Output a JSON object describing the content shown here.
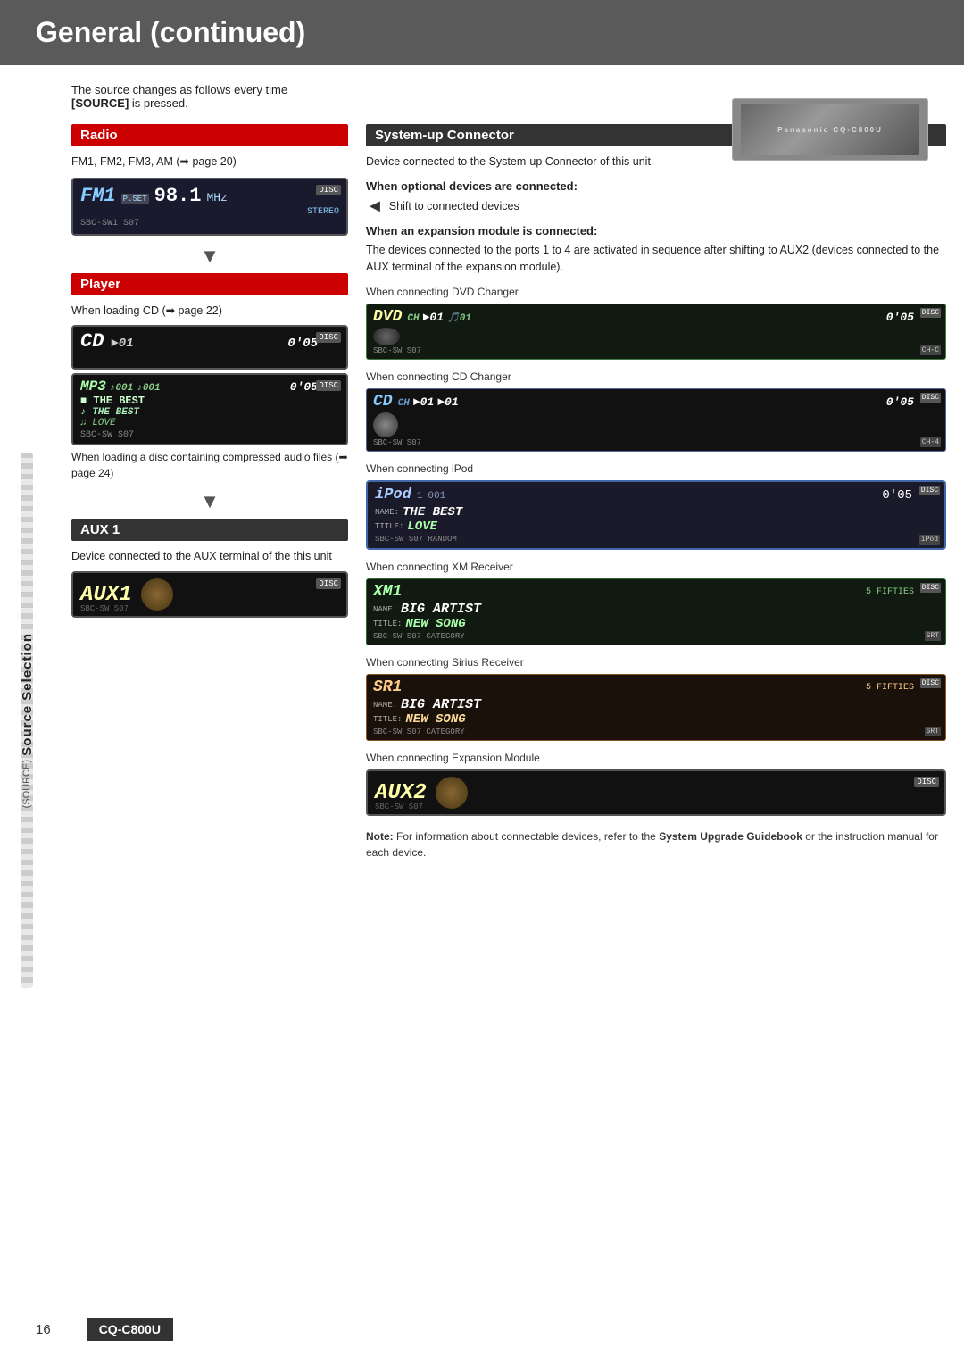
{
  "page": {
    "title": "General (continued)",
    "page_number": "16",
    "model": "CQ-C800U"
  },
  "intro": {
    "line1": "The source changes as follows every time",
    "line2": "[SOURCE] is pressed."
  },
  "sidebar": {
    "main_label": "Source Selection",
    "sub_label": "(SOURCE)"
  },
  "radio_section": {
    "title": "Radio",
    "description": "FM1, FM2, FM3, AM (➡ page 20)",
    "display": {
      "station": "FM1",
      "pset": "P.SET",
      "freq": "98.1",
      "unit": "MHz",
      "badge": "DISC",
      "bottom": "SBC-SW1 S07",
      "stereo": "STEREO"
    }
  },
  "player_section": {
    "title": "Player",
    "description_cd": "When loading CD (➡ page 22)",
    "description_mp3": "When loading a disc containing compressed audio files (➡ page 24)",
    "cd_display": {
      "label": "CD",
      "track": "►01",
      "time": "0'05",
      "badge": "DISC"
    },
    "mp3_display": {
      "label": "MP3",
      "folder": "♪001",
      "track": "♪001",
      "time": "0'05",
      "badge": "DISC",
      "line1": "■ THE BEST",
      "line2": "♪ THE BEST",
      "line3": "♫ LOVE",
      "bottom": "SBC-SW S07"
    }
  },
  "aux1_section": {
    "title": "AUX 1",
    "description": "Device connected to the AUX terminal of the this unit",
    "display": {
      "label": "AUX1",
      "badge": "DISC",
      "bottom": "SBC-SW S07"
    }
  },
  "system_up_section": {
    "title": "System-up Connector",
    "description": "Device connected to the System-up Connector of this unit",
    "when_optional": {
      "header": "When optional devices are connected:",
      "text": "Shift to connected devices"
    },
    "when_expansion": {
      "header": "When an expansion module is connected:",
      "text": "The devices connected to the ports 1 to 4 are activated in sequence after shifting to AUX2 (devices connected to the AUX terminal of the expansion module)."
    },
    "dvd_changer": {
      "when": "When connecting DVD Changer",
      "display": {
        "label": "DVD",
        "ch_label": "CH",
        "arrow": "►01",
        "folder": "🎵01",
        "time": "0'05",
        "badge": "DISC",
        "badge2": "CH-C",
        "bottom": "SBC-SW S07"
      }
    },
    "cd_changer": {
      "when": "When connecting CD Changer",
      "display": {
        "label": "CD",
        "ch_label": "CH",
        "arrow": "►01",
        "track": "►01",
        "time": "0'05",
        "badge": "DISC",
        "badge2": "CH-4",
        "bottom": "SBC-SW S07"
      }
    },
    "ipod": {
      "when": "When connecting iPod",
      "display": {
        "label": "iPod",
        "num": "1",
        "track": "001",
        "time": "0'05",
        "badge": "DISC",
        "badge2": "iPod",
        "name_label": "NAME:",
        "name_val": "THE BEST",
        "title_label": "TITLE:",
        "title_val": "LOVE",
        "bottom": "SBC-SW S07 RANDOM"
      }
    },
    "xm": {
      "when": "When connecting XM Receiver",
      "display": {
        "label": "XM1",
        "channel": "5 FIFTIES",
        "badge": "DISC",
        "name_label": "NAME:",
        "name_val": "BIG ARTIST",
        "title_label": "TITLE:",
        "title_val": "NEW SONG",
        "bottom": "SBC-SW S07 CATEGORY",
        "badge2": "SRT"
      }
    },
    "sirius": {
      "when": "When connecting Sirius Receiver",
      "display": {
        "label": "SR1",
        "channel": "5 FIFTIES",
        "badge": "DISC",
        "name_label": "NAME:",
        "name_val": "BIG ARTIST",
        "title_label": "TITLE:",
        "title_val": "NEW SONG",
        "bottom": "SBC-SW S07 CATEGORY",
        "badge2": "SRT"
      }
    },
    "aux2": {
      "when": "When connecting Expansion Module",
      "display": {
        "label": "AUX2",
        "badge": "DISC",
        "bottom": "SBC-SW S07"
      }
    },
    "note": "Note: For information about connectable devices, refer to the System Upgrade Guidebook or the instruction manual for each device."
  }
}
